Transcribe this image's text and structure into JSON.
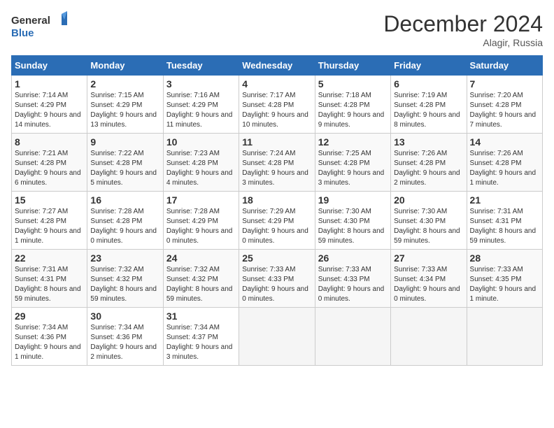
{
  "header": {
    "logo_line1": "General",
    "logo_line2": "Blue",
    "month_title": "December 2024",
    "location": "Alagir, Russia"
  },
  "columns": [
    "Sunday",
    "Monday",
    "Tuesday",
    "Wednesday",
    "Thursday",
    "Friday",
    "Saturday"
  ],
  "weeks": [
    [
      {
        "day": "1",
        "sunrise": "7:14 AM",
        "sunset": "4:29 PM",
        "daylight": "9 hours and 14 minutes."
      },
      {
        "day": "2",
        "sunrise": "7:15 AM",
        "sunset": "4:29 PM",
        "daylight": "9 hours and 13 minutes."
      },
      {
        "day": "3",
        "sunrise": "7:16 AM",
        "sunset": "4:29 PM",
        "daylight": "9 hours and 11 minutes."
      },
      {
        "day": "4",
        "sunrise": "7:17 AM",
        "sunset": "4:28 PM",
        "daylight": "9 hours and 10 minutes."
      },
      {
        "day": "5",
        "sunrise": "7:18 AM",
        "sunset": "4:28 PM",
        "daylight": "9 hours and 9 minutes."
      },
      {
        "day": "6",
        "sunrise": "7:19 AM",
        "sunset": "4:28 PM",
        "daylight": "9 hours and 8 minutes."
      },
      {
        "day": "7",
        "sunrise": "7:20 AM",
        "sunset": "4:28 PM",
        "daylight": "9 hours and 7 minutes."
      }
    ],
    [
      {
        "day": "8",
        "sunrise": "7:21 AM",
        "sunset": "4:28 PM",
        "daylight": "9 hours and 6 minutes."
      },
      {
        "day": "9",
        "sunrise": "7:22 AM",
        "sunset": "4:28 PM",
        "daylight": "9 hours and 5 minutes."
      },
      {
        "day": "10",
        "sunrise": "7:23 AM",
        "sunset": "4:28 PM",
        "daylight": "9 hours and 4 minutes."
      },
      {
        "day": "11",
        "sunrise": "7:24 AM",
        "sunset": "4:28 PM",
        "daylight": "9 hours and 3 minutes."
      },
      {
        "day": "12",
        "sunrise": "7:25 AM",
        "sunset": "4:28 PM",
        "daylight": "9 hours and 3 minutes."
      },
      {
        "day": "13",
        "sunrise": "7:26 AM",
        "sunset": "4:28 PM",
        "daylight": "9 hours and 2 minutes."
      },
      {
        "day": "14",
        "sunrise": "7:26 AM",
        "sunset": "4:28 PM",
        "daylight": "9 hours and 1 minute."
      }
    ],
    [
      {
        "day": "15",
        "sunrise": "7:27 AM",
        "sunset": "4:28 PM",
        "daylight": "9 hours and 1 minute."
      },
      {
        "day": "16",
        "sunrise": "7:28 AM",
        "sunset": "4:28 PM",
        "daylight": "9 hours and 0 minutes."
      },
      {
        "day": "17",
        "sunrise": "7:28 AM",
        "sunset": "4:29 PM",
        "daylight": "9 hours and 0 minutes."
      },
      {
        "day": "18",
        "sunrise": "7:29 AM",
        "sunset": "4:29 PM",
        "daylight": "9 hours and 0 minutes."
      },
      {
        "day": "19",
        "sunrise": "7:30 AM",
        "sunset": "4:30 PM",
        "daylight": "8 hours and 59 minutes."
      },
      {
        "day": "20",
        "sunrise": "7:30 AM",
        "sunset": "4:30 PM",
        "daylight": "8 hours and 59 minutes."
      },
      {
        "day": "21",
        "sunrise": "7:31 AM",
        "sunset": "4:31 PM",
        "daylight": "8 hours and 59 minutes."
      }
    ],
    [
      {
        "day": "22",
        "sunrise": "7:31 AM",
        "sunset": "4:31 PM",
        "daylight": "8 hours and 59 minutes."
      },
      {
        "day": "23",
        "sunrise": "7:32 AM",
        "sunset": "4:32 PM",
        "daylight": "8 hours and 59 minutes."
      },
      {
        "day": "24",
        "sunrise": "7:32 AM",
        "sunset": "4:32 PM",
        "daylight": "8 hours and 59 minutes."
      },
      {
        "day": "25",
        "sunrise": "7:33 AM",
        "sunset": "4:33 PM",
        "daylight": "9 hours and 0 minutes."
      },
      {
        "day": "26",
        "sunrise": "7:33 AM",
        "sunset": "4:33 PM",
        "daylight": "9 hours and 0 minutes."
      },
      {
        "day": "27",
        "sunrise": "7:33 AM",
        "sunset": "4:34 PM",
        "daylight": "9 hours and 0 minutes."
      },
      {
        "day": "28",
        "sunrise": "7:33 AM",
        "sunset": "4:35 PM",
        "daylight": "9 hours and 1 minute."
      }
    ],
    [
      {
        "day": "29",
        "sunrise": "7:34 AM",
        "sunset": "4:36 PM",
        "daylight": "9 hours and 1 minute."
      },
      {
        "day": "30",
        "sunrise": "7:34 AM",
        "sunset": "4:36 PM",
        "daylight": "9 hours and 2 minutes."
      },
      {
        "day": "31",
        "sunrise": "7:34 AM",
        "sunset": "4:37 PM",
        "daylight": "9 hours and 3 minutes."
      },
      null,
      null,
      null,
      null
    ]
  ]
}
